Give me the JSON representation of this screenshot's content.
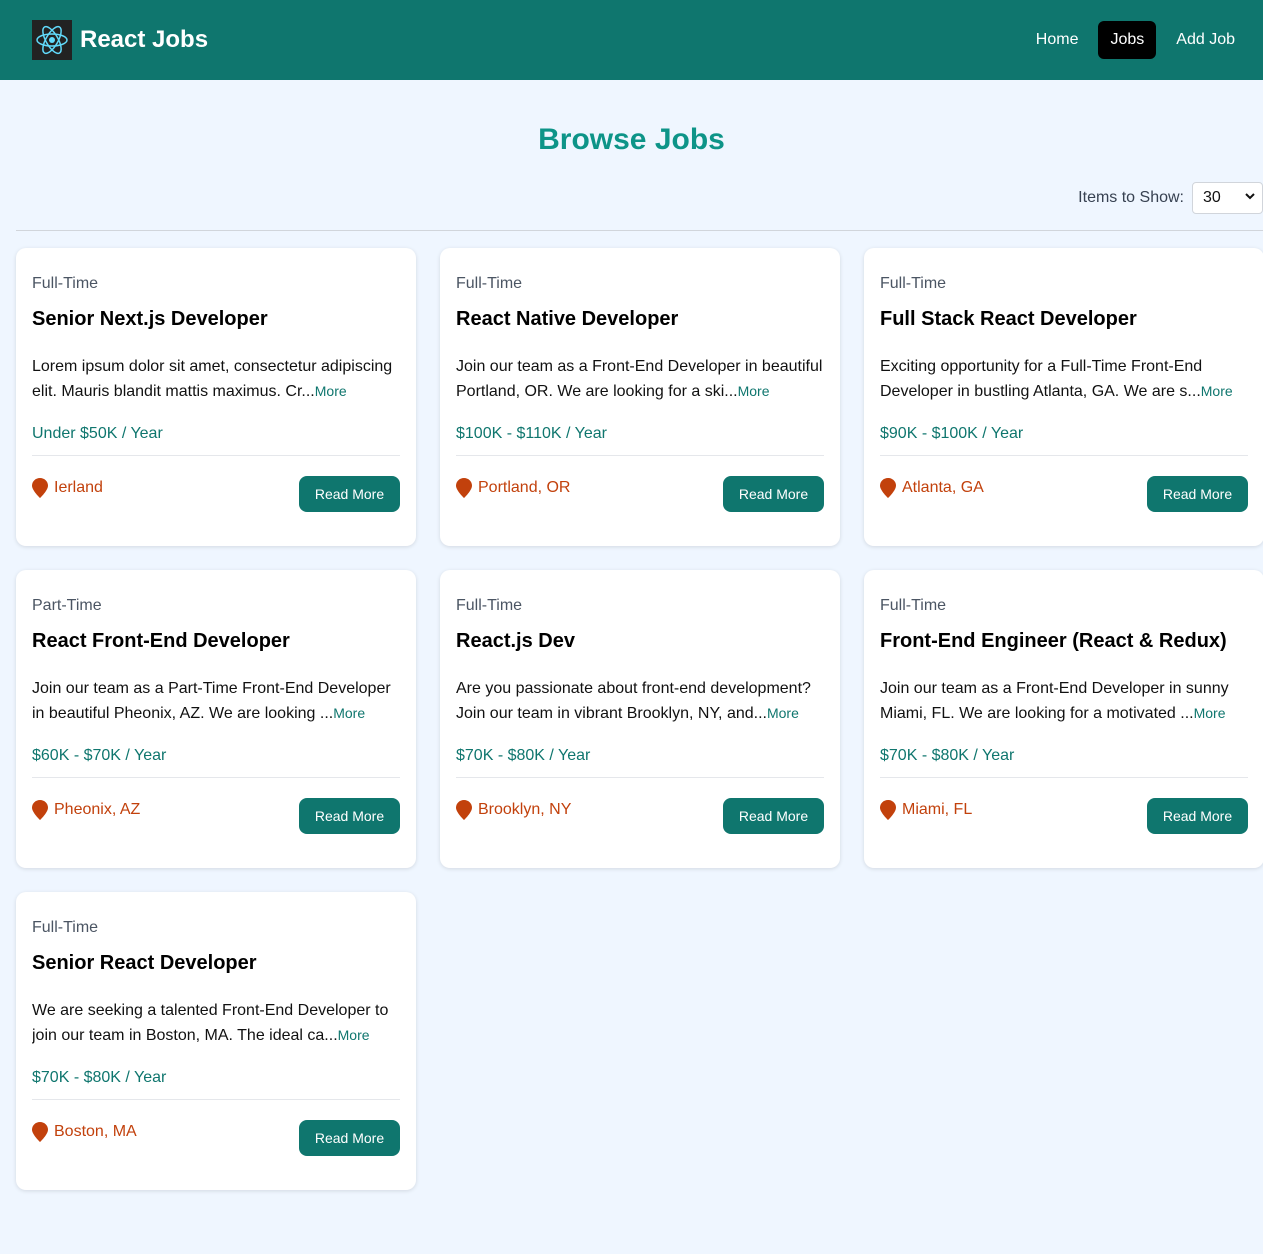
{
  "nav": {
    "brand": "React Jobs",
    "links": [
      {
        "label": "Home",
        "active": false
      },
      {
        "label": "Jobs",
        "active": true
      },
      {
        "label": "Add Job",
        "active": false
      }
    ]
  },
  "page": {
    "title": "Browse Jobs",
    "items_label": "Items to Show:",
    "items_value": "30"
  },
  "more_label": "More",
  "read_more_label": "Read More",
  "jobs": [
    {
      "type": "Full-Time",
      "title": "Senior Next.js Developer",
      "desc": "Lorem ipsum dolor sit amet, consectetur adipiscing elit. Mauris blandit mattis maximus. Cr...",
      "salary": "Under $50K / Year",
      "location": "Ierland"
    },
    {
      "type": "Full-Time",
      "title": "React Native Developer",
      "desc": "Join our team as a Front-End Developer in beautiful Portland, OR. We are looking for a ski...",
      "salary": "$100K - $110K / Year",
      "location": "Portland, OR"
    },
    {
      "type": "Full-Time",
      "title": "Full Stack React Developer",
      "desc": "Exciting opportunity for a Full-Time Front-End Developer in bustling Atlanta, GA. We are s...",
      "salary": "$90K - $100K / Year",
      "location": "Atlanta, GA"
    },
    {
      "type": "Part-Time",
      "title": "React Front-End Developer",
      "desc": "Join our team as a Part-Time Front-End Developer in beautiful Pheonix, AZ. We are looking ...",
      "salary": "$60K - $70K / Year",
      "location": "Pheonix, AZ"
    },
    {
      "type": "Full-Time",
      "title": "React.js Dev",
      "desc": "Are you passionate about front-end development? Join our team in vibrant Brooklyn, NY, and...",
      "salary": "$70K - $80K / Year",
      "location": "Brooklyn, NY"
    },
    {
      "type": "Full-Time",
      "title": "Front-End Engineer (React & Redux)",
      "desc": "Join our team as a Front-End Developer in sunny Miami, FL. We are looking for a motivated ...",
      "salary": "$70K - $80K / Year",
      "location": "Miami, FL"
    },
    {
      "type": "Full-Time",
      "title": "Senior React Developer",
      "desc": "We are seeking a talented Front-End Developer to join our team in Boston, MA. The ideal ca...",
      "salary": "$70K - $80K / Year",
      "location": "Boston, MA"
    }
  ],
  "colors": {
    "nav_bg": "#0f766e",
    "accent": "#0d9488",
    "location": "#c2410c",
    "logo": "#61dafb"
  },
  "icons": [
    "react-logo-icon",
    "map-pin-icon",
    "chevron-down-icon"
  ]
}
